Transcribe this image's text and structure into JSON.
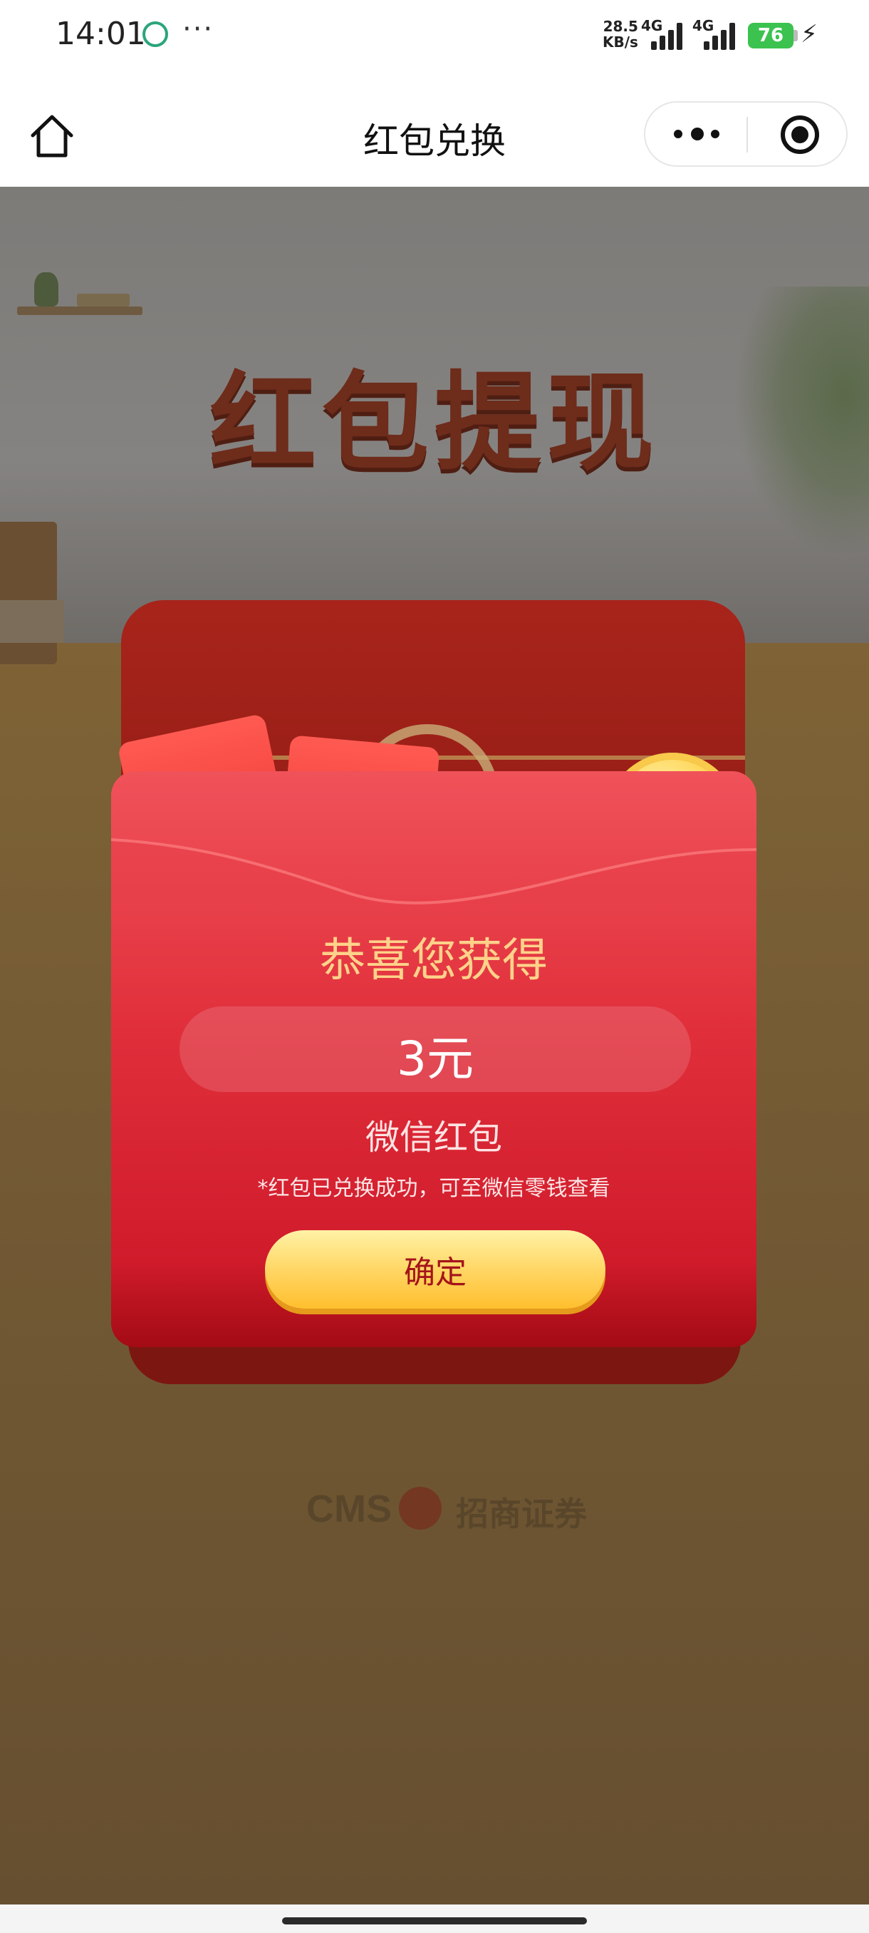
{
  "status_bar": {
    "time": "14:01",
    "app_icon": "wechat-sport-icon",
    "more": "···",
    "net_speed_value": "28.5",
    "net_speed_unit": "KB/s",
    "network_1": "4G",
    "network_2": "4G",
    "battery": "76",
    "charging_icon": "lightning-icon"
  },
  "nav": {
    "title": "红包兑换",
    "home_icon": "home-icon",
    "more_icon": "more-dots-icon",
    "close_icon": "target-close-icon"
  },
  "hero": {
    "title": "红包提现"
  },
  "reward": {
    "congrats": "恭喜您获得",
    "amount": "3元",
    "type": "微信红包",
    "note": "*红包已兑换成功，可至微信零钱查看",
    "confirm_label": "确定",
    "envelope_symbol": "¥"
  },
  "footer": {
    "logo_latin": "CMS",
    "logo_cn": "招商证券"
  },
  "colors": {
    "accent_red": "#e02f3b",
    "gold_text": "#ffd28a",
    "button_yellow": "#ffd45f",
    "button_text": "#a4141a"
  }
}
